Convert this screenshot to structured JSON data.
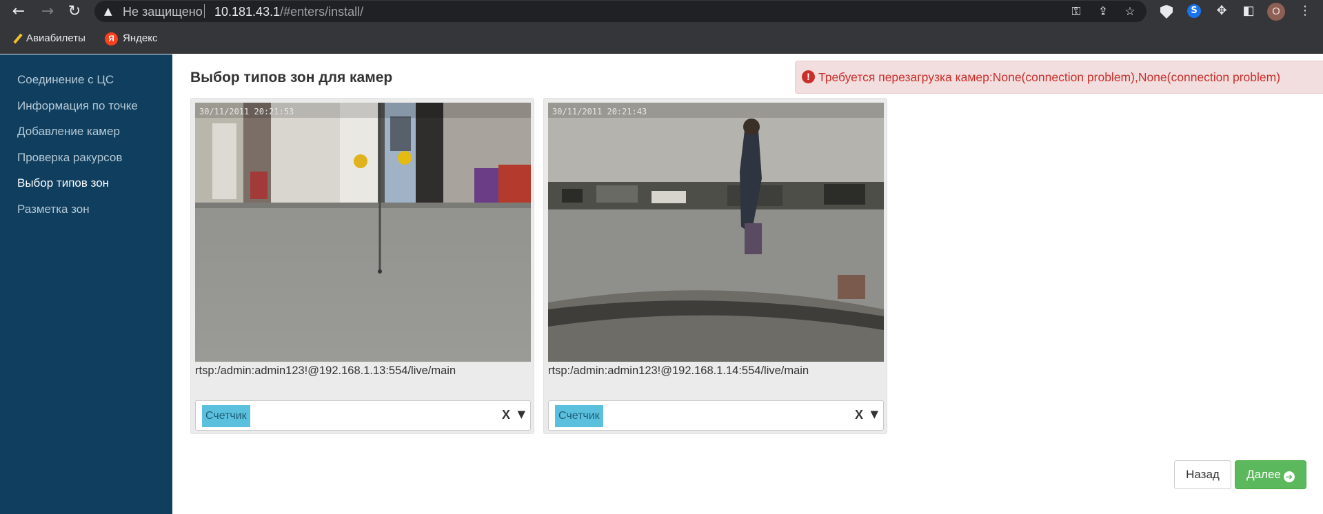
{
  "browser": {
    "insecure_label": "Не защищено",
    "url_host": "10.181.43.1",
    "url_path": "/#enters/install/",
    "profile_initial": "O",
    "icons": {
      "back": "arrow-left-icon",
      "forward": "arrow-right-icon",
      "reload": "reload-icon",
      "warning": "warning-triangle-icon",
      "key": "key-icon",
      "share": "share-icon",
      "star": "star-icon",
      "extensions": "puzzle-icon",
      "sidepanel": "sidepanel-icon",
      "menu": "kebab-menu-icon"
    }
  },
  "bookmarks": [
    {
      "label": "Авиабилеты",
      "icon": "pen-icon"
    },
    {
      "label": "Яндекс",
      "icon": "yandex-icon",
      "icon_text": "Я"
    }
  ],
  "sidebar": {
    "items": [
      {
        "label": "Соединение с ЦС",
        "active": false
      },
      {
        "label": "Информация по точке",
        "active": false
      },
      {
        "label": "Добавление камер",
        "active": false
      },
      {
        "label": "Проверка ракурсов",
        "active": false
      },
      {
        "label": "Выбор типов зон",
        "active": true
      },
      {
        "label": "Разметка зон",
        "active": false
      }
    ]
  },
  "main": {
    "title": "Выбор типов зон для камер",
    "alert": {
      "icon": "!",
      "text": "Требуется перезагрузка камер:None(connection problem),None(connection problem)"
    },
    "cameras": [
      {
        "timestamp": "30/11/2011 20:21:53",
        "url": "rtsp:/admin:admin123!@192.168.1.13:554/live/main",
        "zone_tag": "Счетчик",
        "clear_label": "X",
        "caret": "▼"
      },
      {
        "timestamp": "30/11/2011 20:21:43",
        "url": "rtsp:/admin:admin123!@192.168.1.14:554/live/main",
        "zone_tag": "Счетчик",
        "clear_label": "X",
        "caret": "▼"
      }
    ],
    "buttons": {
      "back": "Назад",
      "next": "Далее"
    }
  },
  "colors": {
    "sidebar_bg": "#0f3e5e",
    "alert_bg": "#f2dede",
    "alert_text": "#c9302c",
    "tag_bg": "#5bc0de",
    "next_btn": "#5cb85c"
  }
}
